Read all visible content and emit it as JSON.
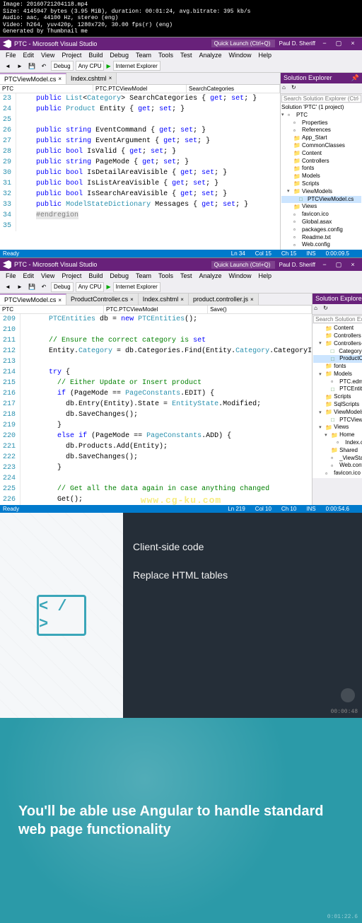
{
  "meta": {
    "line1": "Image: 20160721204118.mp4",
    "line2": "Size: 4145947 bytes (3.95 MiB), duration: 00:01:24, avg.bitrate: 395 kb/s",
    "line3": "Audio: aac, 44100 Hz, stereo (eng)",
    "line4": "Video: h264, yuv420p, 1280x720, 30.00 fps(r) (eng)",
    "line5": "Generated by Thumbnail me"
  },
  "vs1": {
    "title": "PTC - Microsoft Visual Studio",
    "quick_launch": "Quick Launch (Ctrl+Q)",
    "user": "Paul D. Sheriff",
    "menu": [
      "File",
      "Edit",
      "View",
      "Project",
      "Build",
      "Debug",
      "Team",
      "Tools",
      "Test",
      "Analyze",
      "Window",
      "Help"
    ],
    "config": "Debug",
    "platform": "Any CPU",
    "run_target": "Internet Explorer",
    "tabs": [
      {
        "label": "PTCViewModel.cs",
        "active": true
      },
      {
        "label": "Index.cshtml",
        "active": false
      }
    ],
    "nav_left": "PTC",
    "nav_mid": "PTC.PTCViewModel",
    "nav_right": "SearchCategories",
    "lines": [
      {
        "n": "23",
        "code": "    public List<Category> SearchCategories { get; set; }"
      },
      {
        "n": "24",
        "code": "    public Product Entity { get; set; }"
      },
      {
        "n": "25",
        "code": ""
      },
      {
        "n": "26",
        "code": "    public string EventCommand { get; set; }"
      },
      {
        "n": "27",
        "code": "    public string EventArgument { get; set; }"
      },
      {
        "n": "28",
        "code": "    public bool IsValid { get; set; }"
      },
      {
        "n": "29",
        "code": "    public string PageMode { get; set; }"
      },
      {
        "n": "30",
        "code": "    public bool IsDetailAreaVisible { get; set; }"
      },
      {
        "n": "31",
        "code": "    public bool IsListAreaVisible { get; set; }"
      },
      {
        "n": "32",
        "code": "    public bool IsSearchAreaVisible { get; set; }"
      },
      {
        "n": "33",
        "code": "    public ModelStateDictionary Messages { get; set; }"
      },
      {
        "n": "34",
        "code": "    #endregion"
      },
      {
        "n": "35",
        "code": ""
      }
    ],
    "solution": {
      "title": "Solution Explorer",
      "search": "Search Solution Explorer (Ctrl+;)",
      "root": "Solution 'PTC' (1 project)",
      "items": [
        {
          "label": "PTC",
          "depth": 0,
          "exp": true,
          "ico": "csproj"
        },
        {
          "label": "Properties",
          "depth": 1,
          "ico": "wrench"
        },
        {
          "label": "References",
          "depth": 1,
          "ico": "ref"
        },
        {
          "label": "App_Start",
          "depth": 1,
          "ico": "folder"
        },
        {
          "label": "CommonClasses",
          "depth": 1,
          "ico": "folder"
        },
        {
          "label": "Content",
          "depth": 1,
          "ico": "folder"
        },
        {
          "label": "Controllers",
          "depth": 1,
          "ico": "folder"
        },
        {
          "label": "fonts",
          "depth": 1,
          "ico": "folder"
        },
        {
          "label": "Models",
          "depth": 1,
          "ico": "folder"
        },
        {
          "label": "Scripts",
          "depth": 1,
          "ico": "folder"
        },
        {
          "label": "ViewModels",
          "depth": 1,
          "exp": true,
          "ico": "folder"
        },
        {
          "label": "PTCViewModel.cs",
          "depth": 2,
          "ico": "cs",
          "sel": true
        },
        {
          "label": "Views",
          "depth": 1,
          "ico": "folder"
        },
        {
          "label": "favicon.ico",
          "depth": 1,
          "ico": "file"
        },
        {
          "label": "Global.asax",
          "depth": 1,
          "ico": "file"
        },
        {
          "label": "packages.config",
          "depth": 1,
          "ico": "file"
        },
        {
          "label": "Readme.txt",
          "depth": 1,
          "ico": "file"
        },
        {
          "label": "Web.config",
          "depth": 1,
          "ico": "file"
        }
      ]
    },
    "status": {
      "ready": "Ready",
      "ln": "Ln 34",
      "col": "Col 15",
      "ch": "Ch 15",
      "ins": "INS",
      "time": "0:00:09.5"
    }
  },
  "vs2": {
    "title": "PTC - Microsoft Visual Studio",
    "quick_launch": "Quick Launch (Ctrl+Q)",
    "user": "Paul D. Sheriff",
    "menu": [
      "File",
      "Edit",
      "View",
      "Project",
      "Build",
      "Debug",
      "Team",
      "Tools",
      "Test",
      "Analyze",
      "Window",
      "Help"
    ],
    "config": "Debug",
    "platform": "Any CPU",
    "run_target": "Internet Explorer",
    "tabs": [
      {
        "label": "PTCViewModel.cs",
        "active": true
      },
      {
        "label": "ProductController.cs",
        "active": false
      },
      {
        "label": "Index.cshtml",
        "active": false
      },
      {
        "label": "product.controller.js",
        "active": false
      }
    ],
    "nav_left": "PTC",
    "nav_mid": "PTC.PTCViewModel",
    "nav_right": "Save()",
    "lines": [
      {
        "n": "209",
        "code": "      PTCEntities db = new PTCEntities();"
      },
      {
        "n": "210",
        "code": ""
      },
      {
        "n": "211",
        "code": "      // Ensure the correct category is set"
      },
      {
        "n": "212",
        "code": "      Entity.Category = db.Categories.Find(Entity.Category.CategoryI"
      },
      {
        "n": "213",
        "code": ""
      },
      {
        "n": "214",
        "code": "      try {"
      },
      {
        "n": "215",
        "code": "        // Either Update or Insert product"
      },
      {
        "n": "216",
        "code": "        if (PageMode == PageConstants.EDIT) {"
      },
      {
        "n": "217",
        "code": "          db.Entry(Entity).State = EntityState.Modified;"
      },
      {
        "n": "218",
        "code": "          db.SaveChanges();"
      },
      {
        "n": "219",
        "code": "        }"
      },
      {
        "n": "220",
        "code": "        else if (PageMode == PageConstants.ADD) {"
      },
      {
        "n": "221",
        "code": "          db.Products.Add(Entity);"
      },
      {
        "n": "222",
        "code": "          db.SaveChanges();"
      },
      {
        "n": "223",
        "code": "        }"
      },
      {
        "n": "224",
        "code": ""
      },
      {
        "n": "225",
        "code": "        // Get all the data again in case anything changed"
      },
      {
        "n": "226",
        "code": "        Get();"
      }
    ],
    "solution": {
      "title": "Solution Explorer",
      "search": "Search Solution Explorer (Ctrl+;)",
      "items": [
        {
          "label": "Content",
          "depth": 1,
          "ico": "folder"
        },
        {
          "label": "Controllers",
          "depth": 1,
          "ico": "folder"
        },
        {
          "label": "Controllers-Api",
          "depth": 1,
          "exp": true,
          "ico": "folder"
        },
        {
          "label": "CategoryController.cs",
          "depth": 2,
          "ico": "cs"
        },
        {
          "label": "ProductController.cs",
          "depth": 2,
          "ico": "cs",
          "sel": true
        },
        {
          "label": "fonts",
          "depth": 1,
          "ico": "folder"
        },
        {
          "label": "Models",
          "depth": 1,
          "exp": true,
          "ico": "folder"
        },
        {
          "label": "PTC.edmx",
          "depth": 2,
          "ico": "file"
        },
        {
          "label": "PTCEntities.cs",
          "depth": 2,
          "ico": "cs"
        },
        {
          "label": "Scripts",
          "depth": 1,
          "ico": "folder"
        },
        {
          "label": "SqlScripts",
          "depth": 1,
          "ico": "folder"
        },
        {
          "label": "ViewModels",
          "depth": 1,
          "exp": true,
          "ico": "folder"
        },
        {
          "label": "PTCViewModel.cs",
          "depth": 2,
          "ico": "cs"
        },
        {
          "label": "Views",
          "depth": 1,
          "exp": true,
          "ico": "folder"
        },
        {
          "label": "Home",
          "depth": 2,
          "exp": true,
          "ico": "folder"
        },
        {
          "label": "Index.cshtml",
          "depth": 3,
          "ico": "file"
        },
        {
          "label": "Shared",
          "depth": 2,
          "ico": "folder"
        },
        {
          "label": "_ViewStart.cshtml",
          "depth": 2,
          "ico": "file"
        },
        {
          "label": "Web.config",
          "depth": 2,
          "ico": "file"
        },
        {
          "label": "favicon.ico",
          "depth": 1,
          "ico": "file"
        }
      ]
    },
    "status": {
      "ready": "Ready",
      "ln": "Ln 219",
      "col": "Col 10",
      "ch": "Ch 10",
      "ins": "INS",
      "time": "0:00:54.6"
    }
  },
  "watermark": "www.cg-ku.com",
  "slide3": {
    "line1": "Client-side code",
    "line2": "Replace HTML tables",
    "code_glyph": "< / >",
    "timestamp": "00:00:48"
  },
  "slide4": {
    "headline": "You'll be able use Angular to handle standard web page functionality",
    "timestamp": "0:01:22.6"
  }
}
